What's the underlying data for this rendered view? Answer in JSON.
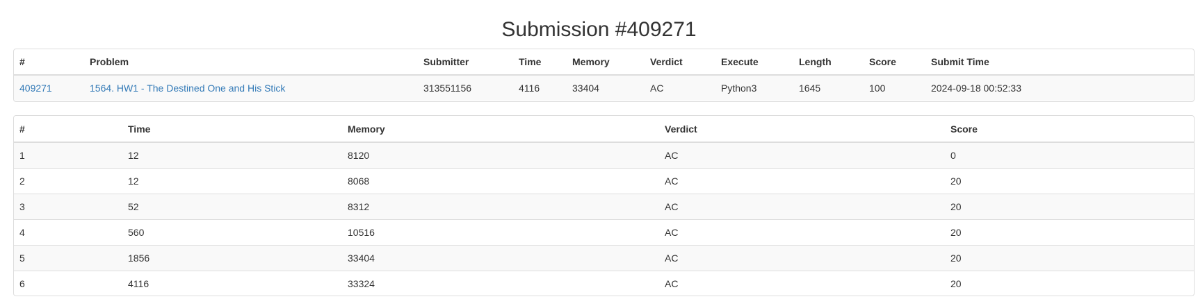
{
  "page": {
    "title": "Submission #409271"
  },
  "summary": {
    "headers": [
      "#",
      "Problem",
      "Submitter",
      "Time",
      "Memory",
      "Verdict",
      "Execute",
      "Length",
      "Score",
      "Submit Time"
    ],
    "row": {
      "id": "409271",
      "problem": "1564. HW1 - The Destined One and His Stick",
      "submitter": "313551156",
      "time": "4116",
      "memory": "33404",
      "verdict": "AC",
      "execute": "Python3",
      "length": "1645",
      "score": "100",
      "submit_time": "2024-09-18 00:52:33"
    }
  },
  "cases": {
    "headers": [
      "#",
      "Time",
      "Memory",
      "Verdict",
      "Score"
    ],
    "rows": [
      {
        "num": "1",
        "time": "12",
        "memory": "8120",
        "verdict": "AC",
        "score": "0"
      },
      {
        "num": "2",
        "time": "12",
        "memory": "8068",
        "verdict": "AC",
        "score": "20"
      },
      {
        "num": "3",
        "time": "52",
        "memory": "8312",
        "verdict": "AC",
        "score": "20"
      },
      {
        "num": "4",
        "time": "560",
        "memory": "10516",
        "verdict": "AC",
        "score": "20"
      },
      {
        "num": "5",
        "time": "1856",
        "memory": "33404",
        "verdict": "AC",
        "score": "20"
      },
      {
        "num": "6",
        "time": "4116",
        "memory": "33324",
        "verdict": "AC",
        "score": "20"
      }
    ]
  },
  "colors": {
    "link": "#337ab7",
    "text": "#333333",
    "border": "#dddddd",
    "stripe": "#f9f9f9"
  }
}
